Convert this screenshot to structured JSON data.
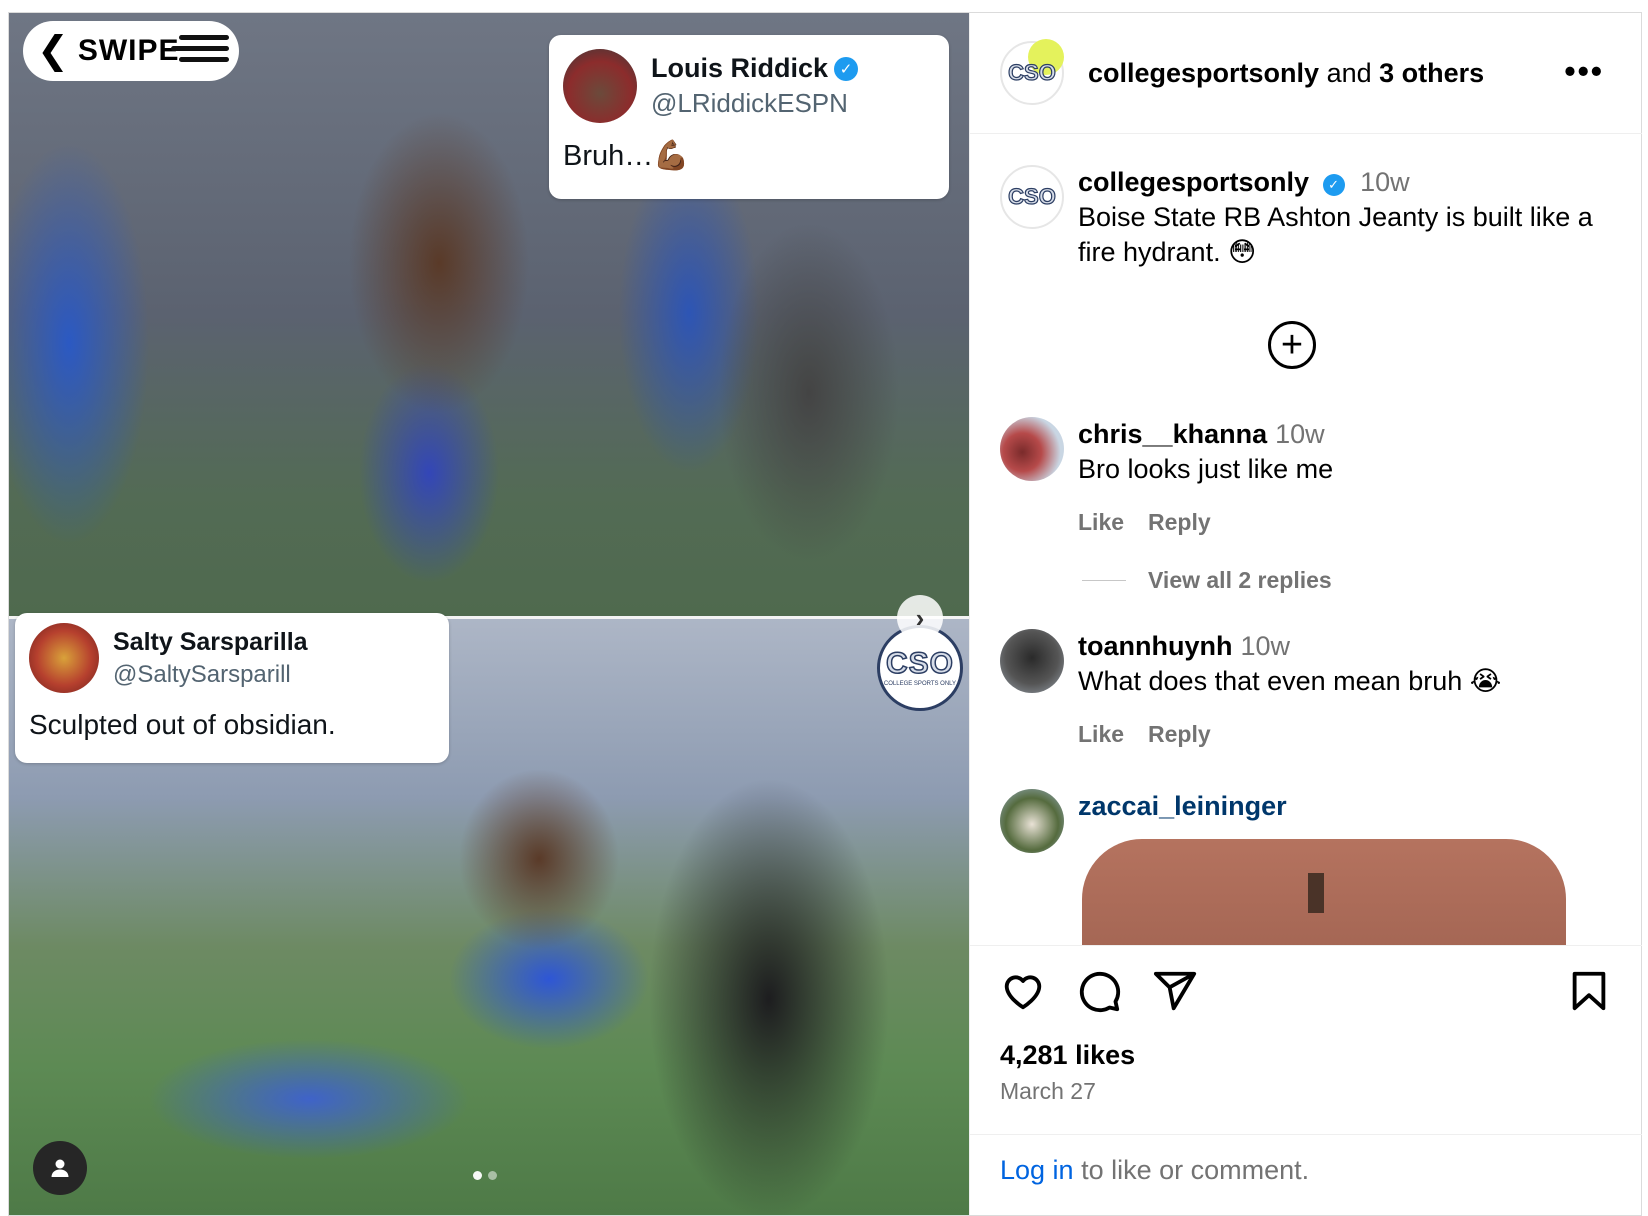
{
  "media": {
    "swipe_label": "SWIPE",
    "tweet_top": {
      "name": "Louis Riddick",
      "handle": "@LRiddickESPN",
      "text": "Bruh…💪🏾"
    },
    "tweet_bottom": {
      "name": "Salty Sarsparilla",
      "handle": "@SaltySarsparill",
      "text": "Sculpted out of obsidian."
    },
    "watermark": {
      "big": "CSO",
      "small": "COLLEGE SPORTS ONLY"
    },
    "carousel": {
      "total": 2,
      "active": 1
    }
  },
  "header": {
    "username": "collegesportsonly",
    "joiner": "and",
    "others": "3 others",
    "avatar_text": "CSO",
    "more_label": "•••"
  },
  "caption": {
    "username": "collegesportsonly",
    "time": "10w",
    "text": "Boise State RB Ashton Jeanty is built like a fire hydrant. 😳",
    "avatar_text": "CSO"
  },
  "expand_label": "+",
  "comments": [
    {
      "username": "chris__khanna",
      "time": "10w",
      "text": "Bro looks just like me",
      "like": "Like",
      "reply": "Reply"
    },
    {
      "username": "toannhuynh",
      "time": "10w",
      "text": "What does that even mean bruh 😭",
      "like": "Like",
      "reply": "Reply"
    },
    {
      "username": "zaccai_leininger",
      "time": "",
      "text": ""
    }
  ],
  "view_replies": "View all 2 replies",
  "likes": "4,281 likes",
  "date": "March 27",
  "login": {
    "link": "Log in",
    "rest": " to like or comment."
  },
  "icons": {
    "like": "heart-icon",
    "comment": "comment-icon",
    "share": "share-icon",
    "save": "bookmark-icon",
    "next": "chevron-right-icon",
    "tag": "user-tag-icon",
    "swipe": "chevron-left-icon"
  },
  "colors": {
    "link": "#0064e0",
    "verified": "#1d9bf0",
    "muted": "#737373"
  }
}
